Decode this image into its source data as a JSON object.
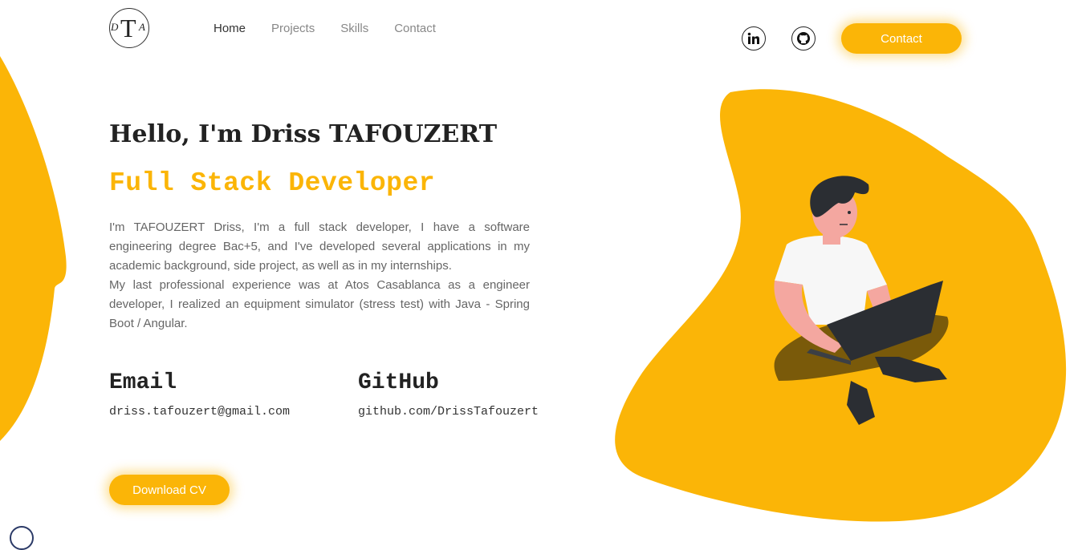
{
  "logo": {
    "d": "D",
    "t": "T",
    "a": "A"
  },
  "nav": {
    "items": [
      "Home",
      "Projects",
      "Skills",
      "Contact"
    ]
  },
  "header": {
    "contact_label": "Contact",
    "social": [
      "linkedin-icon",
      "github-icon"
    ]
  },
  "hero": {
    "greeting": "Hello, I'm Driss TAFOUZERT",
    "role": "Full Stack Developer",
    "bio_1": "I'm TAFOUZERT Driss, I'm a full stack developer, I have a software engineering degree Bac+5, and I've developed several applications in my academic background, side project, as well as in my internships.",
    "bio_2": "My last professional experience was at Atos Casablanca as a engineer developer, I realized an equipment simulator (stress test) with Java - Spring Boot / Angular."
  },
  "contact": {
    "email_label": "Email",
    "email_value": "driss.tafouzert@gmail.com",
    "github_label": "GitHub",
    "github_value": "github.com/DrissTafouzert"
  },
  "actions": {
    "download_cv": "Download CV"
  },
  "colors": {
    "accent": "#fbb507",
    "text": "#222222",
    "muted": "#666666"
  }
}
